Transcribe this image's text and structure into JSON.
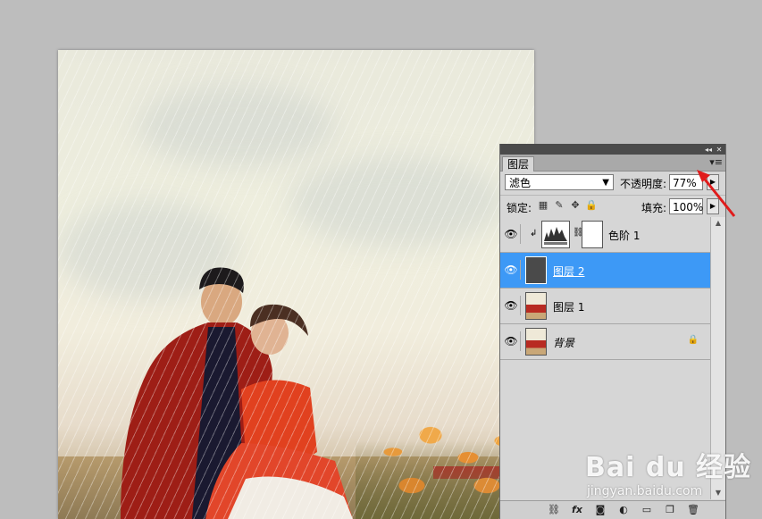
{
  "panel": {
    "tab_label": "图层",
    "menu_icon": "panel-menu-icon",
    "blend_mode": "滤色",
    "opacity_label": "不透明度:",
    "opacity_value": "77%",
    "lock_label": "锁定:",
    "fill_label": "填充:",
    "fill_value": "100%",
    "layers": [
      {
        "name": "色阶 1",
        "type": "adjustment",
        "visible": true,
        "selected": false
      },
      {
        "name": "图层 2",
        "type": "pixel",
        "visible": true,
        "selected": true
      },
      {
        "name": "图层 1",
        "type": "pixel",
        "visible": true,
        "selected": false
      },
      {
        "name": "背景",
        "type": "background",
        "visible": true,
        "selected": false,
        "locked": true
      }
    ],
    "bottom_icons": [
      "link-icon",
      "fx-icon",
      "mask-icon",
      "adjustment-icon",
      "group-folder-icon",
      "new-layer-icon",
      "trash-icon"
    ]
  },
  "watermark": {
    "main": "Bai du 经验",
    "sub": "jingyan.baidu.com"
  },
  "colors": {
    "selected_row": "#3d99f6",
    "arrow": "#e01b1b",
    "panel_bg": "#d6d6d6",
    "workspace": "#bdbdbd"
  }
}
